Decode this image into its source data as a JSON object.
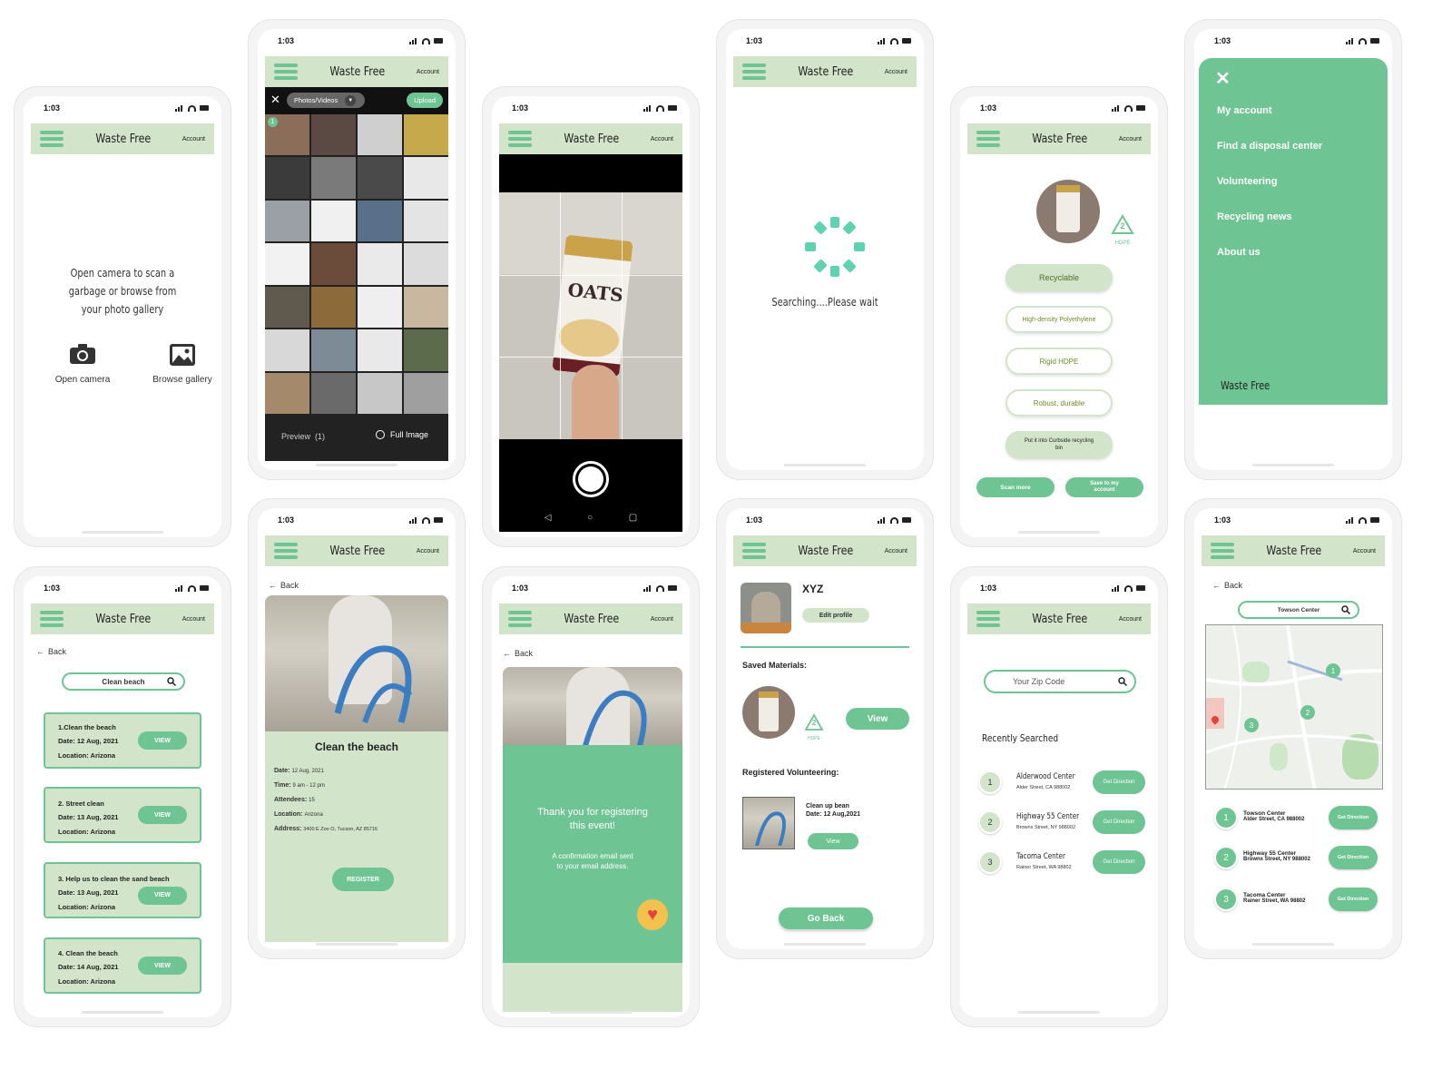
{
  "status_time": "1:03",
  "app": {
    "title": "Waste Free",
    "account": "Account"
  },
  "home": {
    "prompt": "Open camera to scan a garbage or browse from your photo gallery",
    "open_camera": "Open camera",
    "browse_gallery": "Browse gallery"
  },
  "gallery": {
    "photos_videos": "Photos/Videos",
    "upload": "Upload",
    "badge": "1",
    "preview": "Preview",
    "preview_count": "(1)",
    "full_image": "Full Image"
  },
  "searching": {
    "text": "Searching....Please wait"
  },
  "result": {
    "tags": [
      "Recyclable",
      "High-density Polyethylene",
      "Rigid HDPE",
      "Robust, durable",
      "Put it into Curbside recycling bin"
    ],
    "symbol_num": "2",
    "symbol_label": "HDPE",
    "scan_more": "Scan more",
    "save": "Save to my account"
  },
  "menu": {
    "items": [
      "My account",
      "Find a disposal center",
      "Volunteering",
      "Recycling news",
      "About us"
    ],
    "brand": "Waste Free"
  },
  "events": {
    "back": "Back",
    "search": "Clean beach",
    "list": [
      {
        "title": "1.Clean the beach",
        "date": "Date: 12 Aug, 2021",
        "location": "Location: Arizona",
        "view": "VIEW"
      },
      {
        "title": "2. Street clean",
        "date": "Date: 13 Aug, 2021",
        "location": "Location: Arizona",
        "view": "VIEW"
      },
      {
        "title": "3. Help us to clean the sand beach",
        "date": "Date: 13 Aug, 2021",
        "location": "Location: Arizona",
        "view": "VIEW"
      },
      {
        "title": "4. Clean the beach",
        "date": "Date: 14 Aug, 2021",
        "location": "Location: Arizona",
        "view": "VIEW"
      }
    ]
  },
  "detail": {
    "back": "Back",
    "title": "Clean the beach",
    "date_label": "Date:",
    "date": "12 Aug, 2021",
    "time_label": "Time:",
    "time": "9 am - 12 pm",
    "att_label": "Attendees:",
    "attendees": "15",
    "loc_label": "Location:",
    "location": "Arizona",
    "addr_label": "Address:",
    "address": "3400 E Zoo O, Tucson, AZ 85716",
    "register": "REGISTER"
  },
  "thanks": {
    "back": "Back",
    "line1": "Thank you for registering",
    "line2": "this event!",
    "note1": "A confirmation email sent",
    "note2": "to your email address."
  },
  "profile": {
    "name": "XYZ",
    "edit": "Edit profile",
    "saved": "Saved Materials:",
    "view": "View",
    "registered": "Registered Volunteering:",
    "event1": "Clean up bean",
    "event2": "Date: 12 Aug,2021",
    "event_view": "View",
    "go_back": "Go Back"
  },
  "zip": {
    "placeholder": "Your Zip Code",
    "recent": "Recently Searched",
    "get_dir": "Get Direction",
    "items": [
      {
        "n": "1",
        "name": "Alderwood Center",
        "addr": "Alder Street, CA 988002"
      },
      {
        "n": "2",
        "name": "Highway 55 Center",
        "addr": "Browns Street, NY 988002"
      },
      {
        "n": "3",
        "name": "Tacoma Center",
        "addr": "Rainer Street, WA 98802"
      }
    ]
  },
  "map": {
    "back": "Back",
    "search": "Towson Center",
    "get_dir": "Get Direction",
    "items": [
      {
        "n": "1",
        "name": "Towson Center",
        "addr": "Alder Street, CA 988002"
      },
      {
        "n": "2",
        "name": "Highway 55 Center",
        "addr": "Brownx Street, NY 988002"
      },
      {
        "n": "3",
        "name": "Tacoma Center",
        "addr": "Rainer Street, WA 98802"
      }
    ]
  },
  "colors": {
    "green": "#6fc493",
    "light": "#d2e4c9"
  }
}
